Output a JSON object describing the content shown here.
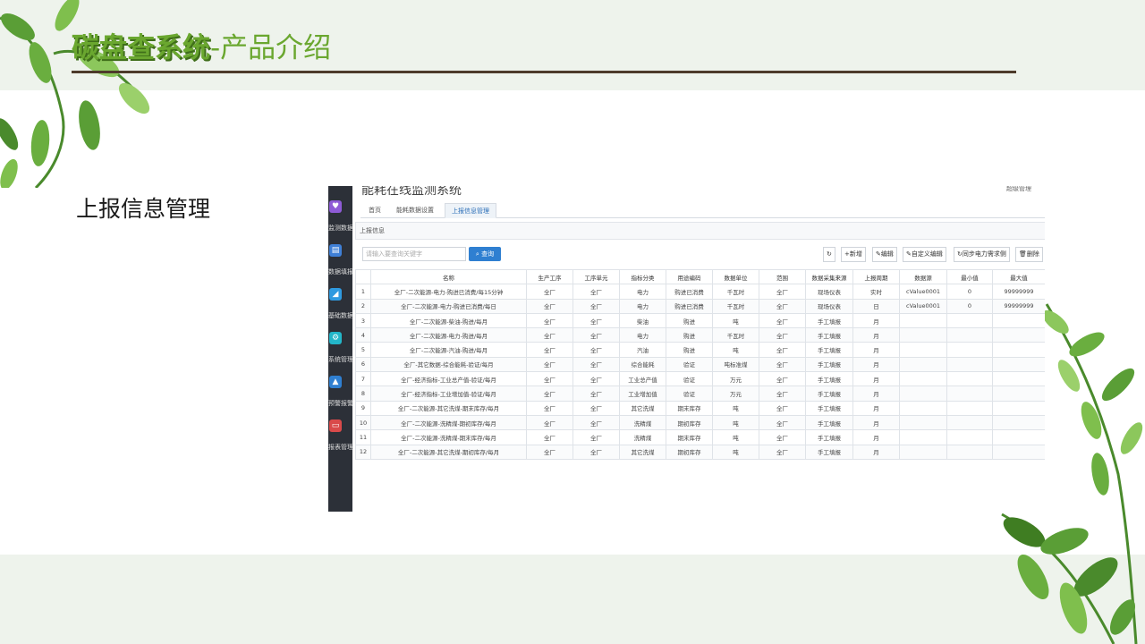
{
  "slide": {
    "title_brand": "碳盘查系统",
    "title_rest": "-产品介绍",
    "section": "上报信息管理"
  },
  "colors": {
    "green": "#6aa72f",
    "brand_shadow": "#3f6e1a",
    "rule": "#4d3b2a",
    "sidebar": "#2c3038",
    "primary": "#2f7fd1"
  },
  "app": {
    "title": "能耗在线监测系统",
    "top_right": "超级管理",
    "sidebar": [
      {
        "icon": "heart-icon",
        "label": "监测数据",
        "color": "#8e5bd6"
      },
      {
        "icon": "form-icon",
        "label": "数据填报",
        "color": "#3f7fd6"
      },
      {
        "icon": "chart-icon",
        "label": "基础数据",
        "color": "#2f9ae0"
      },
      {
        "icon": "gear-icon",
        "label": "系统管理",
        "color": "#23b6c9"
      },
      {
        "icon": "warning-icon",
        "label": "预警报警",
        "color": "#2f7fd1"
      },
      {
        "icon": "monitor-icon",
        "label": "报表管理",
        "color": "#d94a4a"
      }
    ],
    "tabs": [
      "首页",
      "能耗数据设置",
      "上报信息管理"
    ],
    "panel_title": "上报信息",
    "search_placeholder": "请输入要查询关键字",
    "search_label": "查询",
    "toolbar": {
      "refresh": "↻",
      "add": "新增",
      "edit": "编辑",
      "custom_edit": "自定义编辑",
      "sync": "同步电力需求侧",
      "delete": "删除"
    },
    "table": {
      "headers": [
        "",
        "名称",
        "生产工序",
        "工序单元",
        "指标分类",
        "用途编码",
        "数据单位",
        "范围",
        "数据采集来源",
        "上报周期",
        "数据源",
        "最小值",
        "最大值"
      ],
      "rows": [
        [
          "1",
          "全厂-二次能源-电力-购进已消费/每15分钟",
          "全厂",
          "全厂",
          "电力",
          "购进已消费",
          "千瓦时",
          "全厂",
          "现场仪表",
          "实时",
          "cValue0001",
          "0",
          "99999999"
        ],
        [
          "2",
          "全厂-二次能源-电力-购进已消费/每日",
          "全厂",
          "全厂",
          "电力",
          "购进已消费",
          "千瓦时",
          "全厂",
          "现场仪表",
          "日",
          "cValue0001",
          "0",
          "99999999"
        ],
        [
          "3",
          "全厂-二次能源-柴油-购进/每月",
          "全厂",
          "全厂",
          "柴油",
          "购进",
          "吨",
          "全厂",
          "手工填报",
          "月",
          "",
          "",
          ""
        ],
        [
          "4",
          "全厂-二次能源-电力-购进/每月",
          "全厂",
          "全厂",
          "电力",
          "购进",
          "千瓦时",
          "全厂",
          "手工填报",
          "月",
          "",
          "",
          ""
        ],
        [
          "5",
          "全厂-二次能源-汽油-购进/每月",
          "全厂",
          "全厂",
          "汽油",
          "购进",
          "吨",
          "全厂",
          "手工填报",
          "月",
          "",
          "",
          ""
        ],
        [
          "6",
          "全厂-其它数据-综合能耗-验证/每月",
          "全厂",
          "全厂",
          "综合能耗",
          "验证",
          "吨标准煤",
          "全厂",
          "手工填报",
          "月",
          "",
          "",
          ""
        ],
        [
          "7",
          "全厂-经济指标-工业总产值-验证/每月",
          "全厂",
          "全厂",
          "工业总产值",
          "验证",
          "万元",
          "全厂",
          "手工填报",
          "月",
          "",
          "",
          ""
        ],
        [
          "8",
          "全厂-经济指标-工业增加值-验证/每月",
          "全厂",
          "全厂",
          "工业增加值",
          "验证",
          "万元",
          "全厂",
          "手工填报",
          "月",
          "",
          "",
          ""
        ],
        [
          "9",
          "全厂-二次能源-其它洗煤-期末库存/每月",
          "全厂",
          "全厂",
          "其它洗煤",
          "期末库存",
          "吨",
          "全厂",
          "手工填报",
          "月",
          "",
          "",
          ""
        ],
        [
          "10",
          "全厂-二次能源-洗精煤-期初库存/每月",
          "全厂",
          "全厂",
          "洗精煤",
          "期初库存",
          "吨",
          "全厂",
          "手工填报",
          "月",
          "",
          "",
          ""
        ],
        [
          "11",
          "全厂-二次能源-洗精煤-期末库存/每月",
          "全厂",
          "全厂",
          "洗精煤",
          "期末库存",
          "吨",
          "全厂",
          "手工填报",
          "月",
          "",
          "",
          ""
        ],
        [
          "12",
          "全厂-二次能源-其它洗煤-期初库存/每月",
          "全厂",
          "全厂",
          "其它洗煤",
          "期初库存",
          "吨",
          "全厂",
          "手工填报",
          "月",
          "",
          "",
          ""
        ]
      ]
    }
  }
}
